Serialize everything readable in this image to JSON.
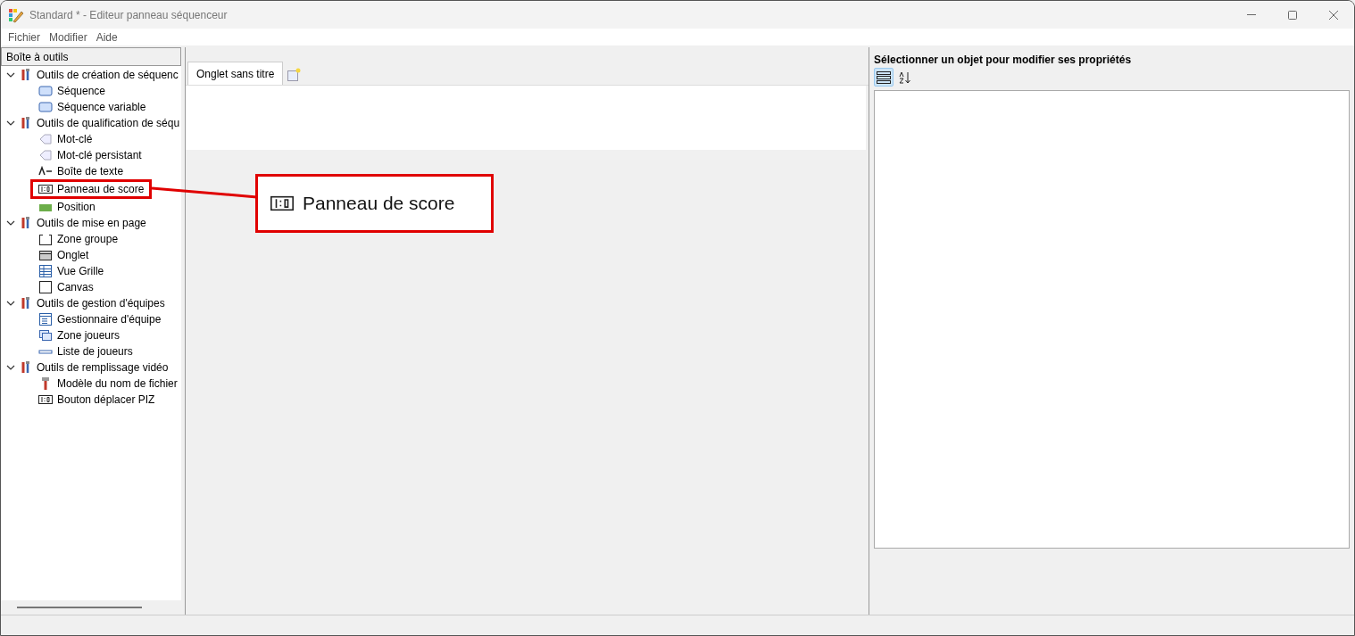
{
  "window": {
    "title": "Standard * - Editeur panneau séquenceur"
  },
  "menu": [
    "Fichier",
    "Modifier",
    "Aide"
  ],
  "toolbox": {
    "title": "Boîte à outils",
    "groups": [
      {
        "label": "Outils de création de séquenc",
        "expanded": true,
        "children": [
          {
            "label": "Séquence",
            "kind": "sequence"
          },
          {
            "label": "Séquence variable",
            "kind": "sequence"
          }
        ]
      },
      {
        "label": "Outils de qualification de séqu",
        "expanded": true,
        "children": [
          {
            "label": "Mot-clé",
            "kind": "tag"
          },
          {
            "label": "Mot-clé persistant",
            "kind": "tag"
          },
          {
            "label": "Boîte de texte",
            "kind": "text"
          },
          {
            "label": "Panneau de score",
            "kind": "score",
            "highlighted": true
          },
          {
            "label": "Position",
            "kind": "position"
          }
        ]
      },
      {
        "label": "Outils de mise en page",
        "expanded": true,
        "children": [
          {
            "label": "Zone groupe",
            "kind": "group"
          },
          {
            "label": "Onglet",
            "kind": "tab"
          },
          {
            "label": "Vue Grille",
            "kind": "grid"
          },
          {
            "label": "Canvas",
            "kind": "canvas"
          }
        ]
      },
      {
        "label": "Outils de gestion d'équipes",
        "expanded": true,
        "children": [
          {
            "label": "Gestionnaire d'équipe",
            "kind": "form"
          },
          {
            "label": "Zone joueurs",
            "kind": "panels"
          },
          {
            "label": "Liste de joueurs",
            "kind": "list"
          }
        ]
      },
      {
        "label": "Outils de remplissage vidéo",
        "expanded": true,
        "children": [
          {
            "label": "Modèle du nom de fichier",
            "kind": "tool"
          },
          {
            "label": "Bouton déplacer PIZ",
            "kind": "score"
          }
        ]
      }
    ]
  },
  "editor": {
    "tabs": [
      {
        "label": "Onglet sans titre",
        "selected": true
      }
    ]
  },
  "properties": {
    "title": "Sélectionner un objet pour modifier ses propriétés",
    "view_buttons": [
      {
        "kind": "categorized",
        "selected": true
      },
      {
        "kind": "alphabetical",
        "selected": false
      }
    ]
  },
  "callout": {
    "label": "Panneau de score",
    "kind": "score"
  }
}
